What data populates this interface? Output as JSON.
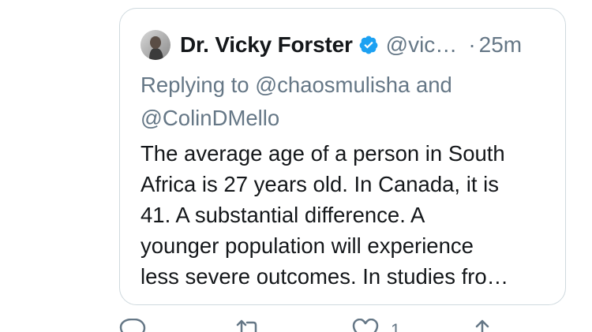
{
  "tweet": {
    "author": {
      "display_name": "Dr. Vicky Forster",
      "handle": "@vic…",
      "verified": true,
      "avatar_icon": "profile-photo-icon"
    },
    "separator": "·",
    "time": "25m",
    "reply_context": {
      "prefix": "Replying to",
      "mention_1": "@chaosmulisha",
      "conjunction": "and",
      "mention_2": "@ColinDMello"
    },
    "text_lines": [
      "The average age of a person in South",
      "Africa is 27 years old. In Canada, it is",
      "41. A substantial difference. A",
      "younger population will experience",
      "less severe outcomes. In studies fro…"
    ]
  },
  "actions": {
    "reply_icon": "reply-icon",
    "retweet_icon": "retweet-icon",
    "like_icon": "like-icon",
    "like_count": "1",
    "share_icon": "share-icon"
  },
  "colors": {
    "text_primary": "#14171a",
    "text_secondary": "#657786",
    "verified_blue": "#1da1f2",
    "card_border": "#cfd9de"
  }
}
